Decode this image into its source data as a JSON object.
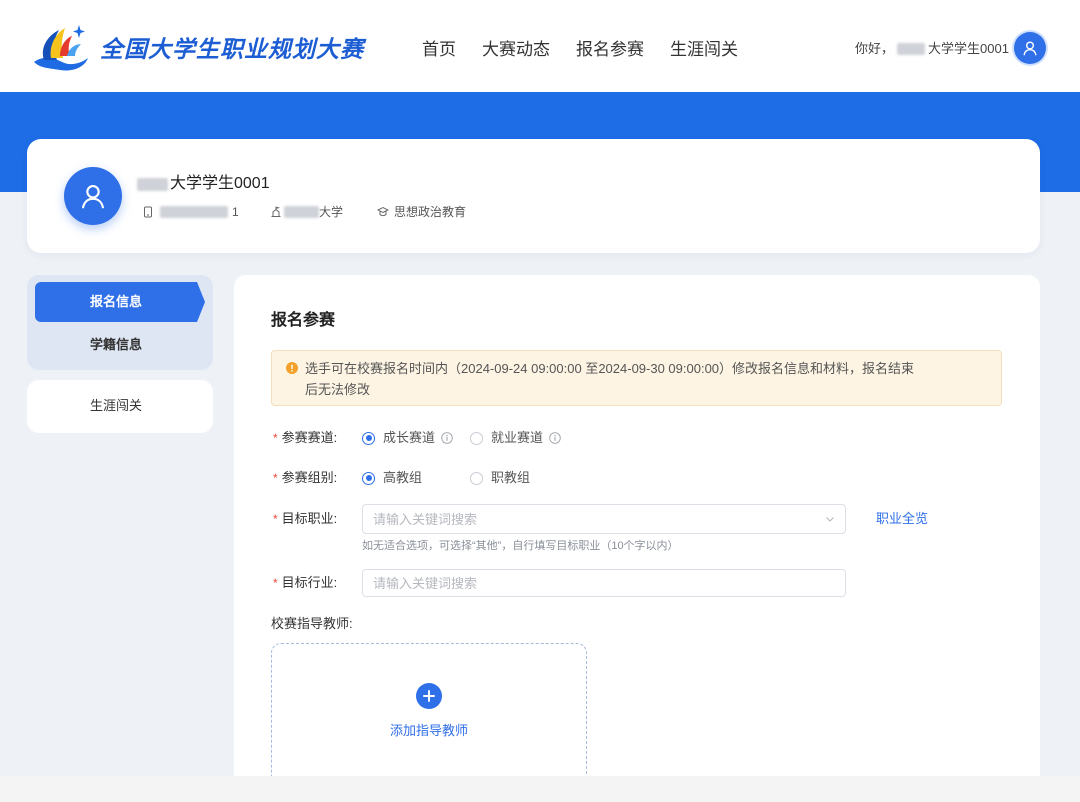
{
  "header": {
    "title": "全国大学生职业规划大赛",
    "nav": [
      "首页",
      "大赛动态",
      "报名参赛",
      "生涯闯关"
    ],
    "greeting": "你好，",
    "username": "大学学生0001"
  },
  "profile": {
    "name": "大学学生0001",
    "phone_suffix": "1",
    "school_suffix": "大学",
    "major": "思想政治教育"
  },
  "sidebar": {
    "items": [
      {
        "label": "报名信息",
        "active": true
      },
      {
        "label": "学籍信息",
        "active": false
      },
      {
        "label": "生涯闯关",
        "active": false
      }
    ]
  },
  "form": {
    "heading": "报名参赛",
    "notice_lines": [
      "选手可在校赛报名时间内（2024-09-24 09:00:00 至2024-09-30 09:00:00）修改报名信息和材料，报名结束",
      "后无法修改"
    ],
    "required_mark": "*",
    "track": {
      "label": "参赛赛道:",
      "options": [
        {
          "label": "成长赛道",
          "checked": true
        },
        {
          "label": "就业赛道",
          "checked": false
        }
      ]
    },
    "group": {
      "label": "参赛组别:",
      "options": [
        {
          "label": "高教组",
          "checked": true
        },
        {
          "label": "职教组",
          "checked": false
        }
      ]
    },
    "target_job": {
      "label": "目标职业:",
      "placeholder": "请输入关键词搜索",
      "link": "职业全览",
      "hint": "如无适合选项，可选择“其他”，自行填写目标职业（10个字以内）"
    },
    "target_industry": {
      "label": "目标行业:",
      "placeholder": "请输入关键词搜索"
    },
    "advisor": {
      "label": "校赛指导教师:",
      "add_label": "添加指导教师"
    }
  },
  "icons": {
    "logo": "logo-icon",
    "avatar": "user-icon",
    "phone": "phone-icon",
    "school": "school-icon",
    "major": "major-icon",
    "notice": "warning-icon",
    "info": "info-icon",
    "select": "chevron-down-icon",
    "add": "plus-circle-icon"
  },
  "colors": {
    "primary": "#2f6fe8",
    "banner": "#1e6ce6",
    "title": "#1c5dd4",
    "page_bg": "#eef1f6",
    "sidebar_bg": "#dee6f4",
    "notice_bg": "#fdf4e4",
    "notice_border": "#f3dfb9",
    "warning": "#f2a22a",
    "required": "#f0483b",
    "dashed_border": "#a7b9de",
    "bottom_bg": "#f4f4f4"
  }
}
